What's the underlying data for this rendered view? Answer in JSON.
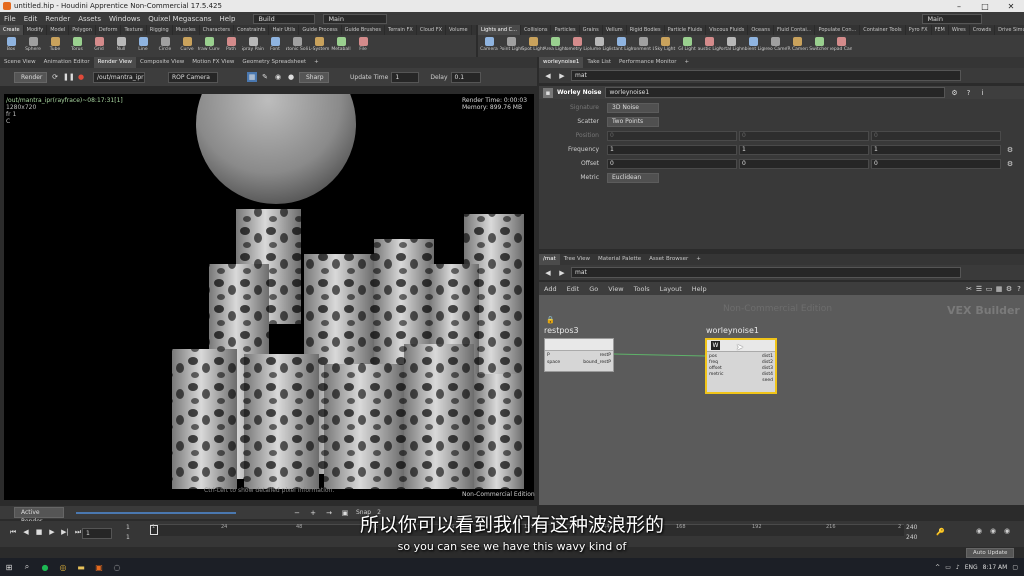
{
  "titlebar": {
    "title": "untitled.hip - Houdini Apprentice Non-Commercial 17.5.425",
    "controls": [
      "–",
      "□",
      "✕"
    ]
  },
  "menubar": {
    "items": [
      "File",
      "Edit",
      "Render",
      "Assets",
      "Windows",
      "Quixel Megascans",
      "Help"
    ],
    "desktop_left": "Build",
    "desktop_mid": "Main",
    "desktop_right": "Main"
  },
  "shelf_left": {
    "tabs": [
      "Create",
      "Modify",
      "Model",
      "Polygon",
      "Deform",
      "Texture",
      "Rigging",
      "Muscles",
      "Characters",
      "Constraints",
      "Hair Utils",
      "Guide Process",
      "Guide Brushes",
      "Terrain FX",
      "Cloud FX",
      "Volume"
    ],
    "tools": [
      "Box",
      "Sphere",
      "Tube",
      "Torus",
      "Grid",
      "Null",
      "Line",
      "Circle",
      "Curve",
      "Draw Curve",
      "Path",
      "Spray Paint",
      "Font",
      "Platonic Solids",
      "L-System",
      "Metaball",
      "File"
    ]
  },
  "shelf_right": {
    "tabs": [
      "Lights and C...",
      "Collisions",
      "Particles",
      "Grains",
      "Vellum",
      "Rigid Bodies",
      "Particle Fluids",
      "Viscous Fluids",
      "Oceans",
      "Fluid Contai...",
      "Populate Con...",
      "Container Tools",
      "Pyro FX",
      "FEM",
      "Wires",
      "Crowds",
      "Drive Simula..."
    ],
    "tools": [
      "Camera",
      "Point Light",
      "Spot Light",
      "Area Light",
      "Geometry Light",
      "Volume Light",
      "Distant Light",
      "Environment Light",
      "Sky Light",
      "GI Light",
      "Caustic Light",
      "Portal Light",
      "Ambient Light",
      "Stereo Camera",
      "VR Camera",
      "Switcher",
      "Gamepad Camera"
    ]
  },
  "left_pane": {
    "tabs": [
      "Scene View",
      "Animation Editor",
      "Render View",
      "Composite View",
      "Motion FX View",
      "Geometry Spreadsheet"
    ],
    "active_tab": "Render View",
    "render_button": "Render",
    "output_path": "/out/mantra_ipr",
    "camera": "ROP Camera",
    "sharp": "Sharp",
    "update_time_label": "Update Time",
    "update_time_value": "1",
    "delay_label": "Delay",
    "delay_value": "0.1"
  },
  "viewport": {
    "info_line1": "/out/mantra_ipr(rayfrace)~08:17:31[1]",
    "info_line2": "1280x720",
    "info_line3": "fr 1",
    "info_line4": "C",
    "render_time": "Render Time: 0:00:03",
    "memory": "Memory:    899.76 MB",
    "hint": "Ctrl-Left to show detailed pixel information.",
    "nce": "Non-Commercial Edition"
  },
  "left_bottom": {
    "mode": "Active Render",
    "snap_label": "Snap",
    "snap_value": "2"
  },
  "param_pane": {
    "tabs": [
      "worleynoise1",
      "Take List",
      "Performance Monitor"
    ],
    "path": "mat",
    "node_type": "Worley Noise",
    "node_name": "worleynoise1",
    "rows": [
      {
        "label": "Signature",
        "value": "3D Noise",
        "kind": "menu",
        "dim": true
      },
      {
        "label": "Scatter",
        "value": "Two Points",
        "kind": "menu",
        "dim": false
      },
      {
        "label": "Position",
        "values": [
          "0",
          "0",
          "0"
        ],
        "kind": "vec",
        "dim": true
      },
      {
        "label": "Frequency",
        "values": [
          "1",
          "1",
          "1"
        ],
        "kind": "vec",
        "dim": false
      },
      {
        "label": "Offset",
        "values": [
          "0",
          "0",
          "0"
        ],
        "kind": "vec",
        "dim": false
      },
      {
        "label": "Metric",
        "value": "Euclidean",
        "kind": "menu",
        "dim": false
      }
    ]
  },
  "network_pane": {
    "tabs": [
      "/mat",
      "Tree View",
      "Material Palette",
      "Asset Browser"
    ],
    "path": "mat",
    "menu": [
      "Add",
      "Edit",
      "Go",
      "View",
      "Tools",
      "Layout",
      "Help"
    ],
    "watermark": "Non-Commercial Edition",
    "context_label": "VEX Builder",
    "node1": {
      "name": "restpos3",
      "inputs": [
        "P",
        "space"
      ],
      "outputs": [
        "restP",
        "bound_restP"
      ]
    },
    "node2": {
      "name": "worleynoise1",
      "badge": "W",
      "inputs": [
        "pos",
        "freq",
        "offset",
        "metric"
      ],
      "outputs": [
        "dist1",
        "dist2",
        "dist3",
        "dist4",
        "seed"
      ]
    }
  },
  "timeline": {
    "frame": "1",
    "range_start": "1",
    "range_start2": "1",
    "ticks": [
      "1",
      "24",
      "48",
      "72",
      "96",
      "120",
      "144",
      "168",
      "192",
      "216",
      "2"
    ],
    "end1": "240",
    "end2": "240",
    "auto_update": "Auto Update"
  },
  "subtitles": {
    "zh": "所以你可以看到我们有这种波浪形的",
    "en": "so you can see we have this wavy kind of"
  },
  "taskbar": {
    "lang": "ENG",
    "time": "8:17 AM"
  },
  "colors": {
    "houdini_orange": "#e56a1e",
    "node_selected": "#f0c419",
    "viewport_bg": "#000000"
  }
}
